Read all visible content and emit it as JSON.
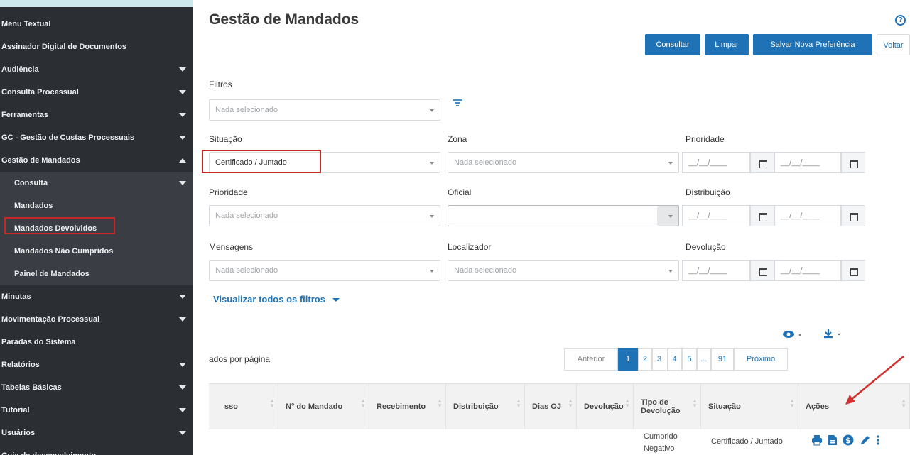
{
  "sidebar": {
    "items": [
      {
        "label": "Menu Textual",
        "sub": false,
        "arrow": ""
      },
      {
        "label": "Assinador Digital de Documentos",
        "sub": false,
        "arrow": ""
      },
      {
        "label": "Audiência",
        "sub": false,
        "arrow": "down"
      },
      {
        "label": "Consulta Processual",
        "sub": false,
        "arrow": "down"
      },
      {
        "label": "Ferramentas",
        "sub": false,
        "arrow": "down"
      },
      {
        "label": "GC - Gestão de Custas Processuais",
        "sub": false,
        "arrow": "down"
      },
      {
        "label": "Gestão de Mandados",
        "sub": false,
        "arrow": "up"
      },
      {
        "label": "Consulta",
        "sub": true,
        "arrow": "down"
      },
      {
        "label": "Mandados",
        "sub": true,
        "arrow": ""
      },
      {
        "label": "Mandados Devolvidos",
        "sub": true,
        "arrow": ""
      },
      {
        "label": "Mandados Não Cumpridos",
        "sub": true,
        "arrow": ""
      },
      {
        "label": "Painel de Mandados",
        "sub": true,
        "arrow": ""
      },
      {
        "label": "Minutas",
        "sub": false,
        "arrow": "down"
      },
      {
        "label": "Movimentação Processual",
        "sub": false,
        "arrow": "down"
      },
      {
        "label": "Paradas do Sistema",
        "sub": false,
        "arrow": ""
      },
      {
        "label": "Relatórios",
        "sub": false,
        "arrow": "down"
      },
      {
        "label": "Tabelas Básicas",
        "sub": false,
        "arrow": "down"
      },
      {
        "label": "Tutorial",
        "sub": false,
        "arrow": "down"
      },
      {
        "label": "Usuários",
        "sub": false,
        "arrow": "down"
      },
      {
        "label": "Guia de desenvolvimento",
        "sub": false,
        "arrow": ""
      }
    ]
  },
  "page": {
    "title": "Gestão de Mandados",
    "help": "?"
  },
  "toolbar": {
    "consultar": "Consultar",
    "limpar": "Limpar",
    "salvar": "Salvar Nova Preferência",
    "voltar": "Voltar"
  },
  "filters": {
    "filtros_label": "Filtros",
    "filtros_value": "Nada selecionado",
    "situacao_label": "Situação",
    "situacao_value": "Certificado / Juntado",
    "zona_label": "Zona",
    "zona_value": "Nada selecionado",
    "prioridade_label": "Prioridade",
    "prioridade2_label": "Prioridade",
    "prioridade2_value": "Nada selecionado",
    "oficial_label": "Oficial",
    "oficial_value": "",
    "distribuicao_label": "Distribuição",
    "mensagens_label": "Mensagens",
    "mensagens_value": "Nada selecionado",
    "localizador_label": "Localizador",
    "localizador_value": "Nada selecionado",
    "devolucao_label": "Devolução",
    "date_placeholder": "__/__/____",
    "visualizar_todos": "Visualizar todos os filtros"
  },
  "list": {
    "per_page": "ados por página",
    "pagination": [
      "Anterior",
      "1",
      "2",
      "3",
      "4",
      "5",
      "...",
      "91",
      "Próximo"
    ]
  },
  "table": {
    "columns": [
      "sso",
      "N° do Mandado",
      "Recebimento",
      "Distribuição",
      "Dias OJ",
      "Devolução",
      "Tipo de Devolução",
      "Situação",
      "Ações"
    ],
    "row": {
      "tipo": "Cumprido Negativo",
      "situacao": "Certificado / Juntado"
    }
  },
  "icons": [
    "eye-icon",
    "download-icon",
    "print-icon",
    "document-icon",
    "dollar-icon",
    "edit-icon",
    "more-icon"
  ],
  "colors": {
    "accent": "#1f72b5",
    "sidebar": "#2b2e33",
    "highlight": "#c62828"
  }
}
